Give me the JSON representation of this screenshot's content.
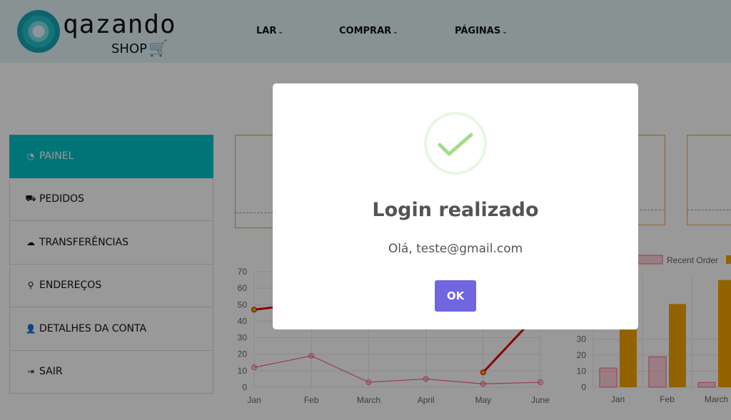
{
  "brand": {
    "name": "qazando",
    "sub": "SHOP",
    "cart_icon": "cart-icon"
  },
  "nav": [
    {
      "label": "LAR"
    },
    {
      "label": "COMPRAR"
    },
    {
      "label": "PÁGINAS"
    }
  ],
  "sidebar": {
    "items": [
      {
        "label": "PAINEL",
        "icon": "dashboard-icon",
        "active": true
      },
      {
        "label": "PEDIDOS",
        "icon": "cart-icon"
      },
      {
        "label": "TRANSFERÊNCIAS",
        "icon": "cloud-download-icon"
      },
      {
        "label": "ENDEREÇOS",
        "icon": "map-marker-icon"
      },
      {
        "label": "DETALHES DA CONTA",
        "icon": "user-icon"
      },
      {
        "label": "SAIR",
        "icon": "sign-out-icon"
      }
    ]
  },
  "colors": {
    "accent": "#00c1c7",
    "ok_button": "#7066e0",
    "check": "#a5dc86",
    "bar_series": "#f5a300",
    "line_series": "#e00000"
  },
  "chart_data": [
    {
      "type": "line",
      "categories": [
        "Jan",
        "Feb",
        "March",
        "April",
        "May",
        "June"
      ],
      "ylim": [
        0,
        70
      ],
      "yticks": [
        0,
        10,
        20,
        30,
        40,
        50,
        60,
        70
      ],
      "series": [
        {
          "values": [
            47,
            51,
            null,
            null,
            9,
            46
          ],
          "color": "#e00000"
        },
        {
          "values": [
            12,
            19,
            3,
            5,
            2,
            3
          ],
          "color": "#ff6384"
        }
      ]
    },
    {
      "type": "bar",
      "categories": [
        "Jan",
        "Feb",
        "March"
      ],
      "ylim": [
        0,
        70
      ],
      "yticks": [
        0,
        10,
        20,
        30
      ],
      "series": [
        {
          "name": "Recent Order",
          "values": [
            12,
            19,
            3
          ],
          "color": "#ffb1c1"
        },
        {
          "values": [
            36,
            52,
            67
          ],
          "color": "#f5a300"
        }
      ]
    }
  ],
  "modal": {
    "title": "Login realizado",
    "text": "Olá, teste@gmail.com",
    "button": "OK",
    "icon": "success-check-icon"
  }
}
